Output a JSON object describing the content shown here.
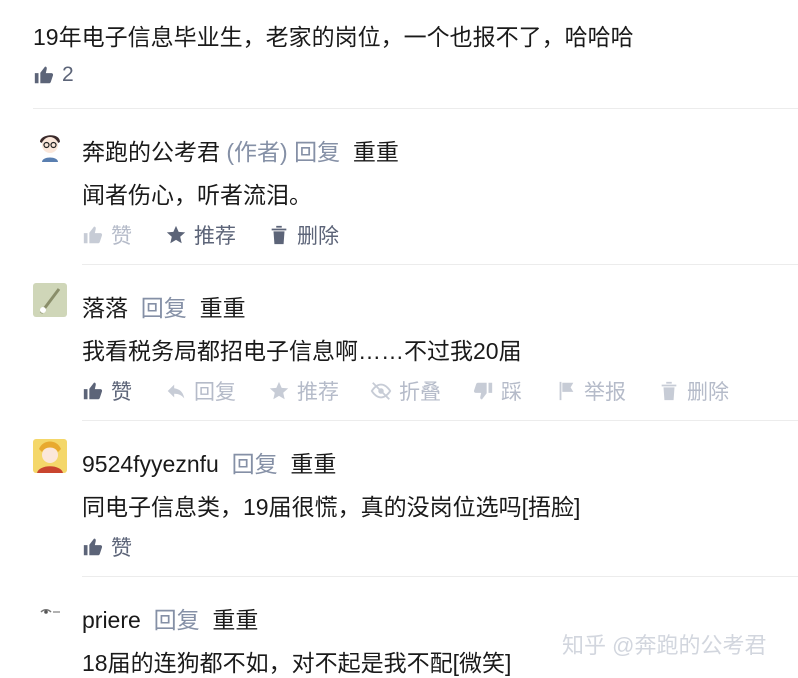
{
  "top_comment": {
    "text": "19年电子信息毕业生，老家的岗位，一个也报不了，哈哈哈",
    "like_count": "2"
  },
  "replies": [
    {
      "author": "奔跑的公考君",
      "author_tag": "(作者)",
      "reply_label": "回复",
      "reply_to": "重重",
      "text": "闻者伤心，听者流泪。",
      "actions": {
        "like": "赞",
        "recommend": "推荐",
        "delete": "删除"
      }
    },
    {
      "author": "落落",
      "reply_label": "回复",
      "reply_to": "重重",
      "text": "我看税务局都招电子信息啊……不过我20届",
      "actions": {
        "like": "赞",
        "reply": "回复",
        "recommend": "推荐",
        "fold": "折叠",
        "dislike": "踩",
        "report": "举报",
        "delete": "删除"
      }
    },
    {
      "author": "9524fyyeznfu",
      "reply_label": "回复",
      "reply_to": "重重",
      "text": "同电子信息类，19届很慌，真的没岗位选吗[捂脸]",
      "actions": {
        "like": "赞"
      }
    },
    {
      "author": "priere",
      "reply_label": "回复",
      "reply_to": "重重",
      "text": "18届的连狗都不如，对不起是我不配[微笑]"
    }
  ],
  "watermark": "知乎 @奔跑的公考君",
  "colors": {
    "text": "#1a1a1a",
    "meta": "#8590a6",
    "muted": "#b5bbc9",
    "divider": "#ececec"
  },
  "icons": [
    "thumb-up-icon",
    "star-icon",
    "trash-icon",
    "reply-arrow-icon",
    "eye-slash-icon",
    "thumb-down-icon",
    "flag-icon"
  ]
}
